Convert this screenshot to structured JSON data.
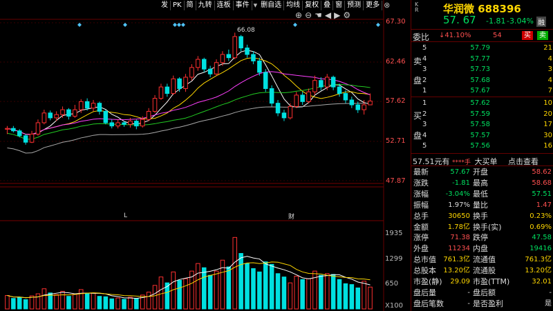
{
  "toolbar": {
    "items": [
      "发",
      "PK",
      "简",
      "九转",
      "连板",
      "事件",
      "删自选",
      "均线",
      "复权",
      "叠",
      "窗",
      "预测",
      "更多"
    ],
    "icons": [
      "fold-icon",
      "close-icon"
    ]
  },
  "controls": {
    "icons": [
      "zoom-in-icon",
      "zoom-out-icon",
      "hand-icon",
      "prev-icon",
      "next-icon",
      "settings-icon"
    ]
  },
  "price_axis": [
    "67.30",
    "62.46",
    "57.62",
    "52.71",
    "47.87"
  ],
  "volume_axis": [
    "1935",
    "1299",
    "650",
    "X100"
  ],
  "high_label": "66.08",
  "markers": {
    "l": "L",
    "cai": "财"
  },
  "chart_data": {
    "type": "candlestick",
    "ylim": [
      47.87,
      67.3
    ],
    "price_ticks": [
      67.3,
      62.46,
      57.62,
      52.71,
      47.87
    ],
    "volume_ticks": [
      1935,
      1299,
      650
    ],
    "volume_unit": "X100",
    "high": 66.08,
    "candles": [
      [
        54.2,
        54.3,
        53.6,
        54.6
      ],
      [
        54.3,
        54.0,
        53.8,
        54.6
      ],
      [
        54.0,
        53.4,
        53.2,
        54.2
      ],
      [
        53.4,
        52.6,
        52.3,
        53.6
      ],
      [
        52.6,
        53.6,
        52.5,
        54.0
      ],
      [
        53.6,
        55.0,
        53.4,
        55.4
      ],
      [
        55.0,
        56.2,
        54.8,
        56.6
      ],
      [
        56.2,
        55.6,
        55.3,
        56.5
      ],
      [
        55.6,
        56.0,
        55.2,
        56.4
      ],
      [
        56.0,
        56.6,
        55.6,
        57.0
      ],
      [
        56.6,
        55.8,
        55.4,
        56.8
      ],
      [
        55.8,
        56.6,
        55.6,
        57.2
      ],
      [
        56.6,
        57.6,
        56.2,
        57.9
      ],
      [
        57.6,
        56.8,
        56.5,
        58.0
      ],
      [
        56.8,
        57.4,
        56.4,
        57.8
      ],
      [
        57.4,
        56.4,
        56.0,
        57.6
      ],
      [
        56.4,
        55.0,
        54.8,
        56.6
      ],
      [
        55.0,
        54.6,
        54.3,
        55.4
      ],
      [
        54.6,
        55.0,
        54.3,
        55.4
      ],
      [
        55.0,
        54.8,
        54.5,
        55.2
      ],
      [
        54.8,
        55.2,
        54.4,
        55.6
      ],
      [
        55.2,
        54.6,
        54.2,
        55.4
      ],
      [
        54.6,
        55.4,
        54.4,
        55.8
      ],
      [
        55.4,
        56.4,
        55.2,
        56.8
      ],
      [
        56.4,
        58.0,
        56.2,
        58.4
      ],
      [
        58.0,
        59.4,
        57.8,
        59.8
      ],
      [
        59.4,
        58.6,
        58.2,
        59.8
      ],
      [
        58.6,
        60.4,
        58.4,
        60.8
      ],
      [
        60.4,
        59.2,
        58.8,
        60.6
      ],
      [
        59.2,
        60.6,
        58.8,
        61.0
      ],
      [
        60.6,
        61.8,
        60.2,
        62.2
      ],
      [
        61.8,
        62.8,
        61.4,
        63.2
      ],
      [
        62.8,
        61.6,
        61.2,
        63.0
      ],
      [
        61.6,
        61.0,
        60.6,
        62.0
      ],
      [
        61.0,
        62.4,
        60.8,
        62.8
      ],
      [
        62.4,
        63.4,
        62.0,
        63.8
      ],
      [
        63.4,
        63.0,
        62.6,
        64.0
      ],
      [
        63.0,
        65.6,
        62.8,
        66.08
      ],
      [
        65.6,
        64.2,
        63.8,
        65.8
      ],
      [
        64.2,
        63.4,
        63.0,
        64.6
      ],
      [
        63.4,
        62.6,
        62.2,
        63.8
      ],
      [
        62.6,
        61.2,
        60.8,
        63.0
      ],
      [
        61.2,
        59.2,
        58.8,
        61.6
      ],
      [
        59.2,
        57.4,
        57.0,
        59.6
      ],
      [
        57.4,
        56.2,
        55.8,
        57.8
      ],
      [
        56.2,
        55.6,
        55.2,
        56.6
      ],
      [
        55.6,
        57.0,
        55.4,
        57.4
      ],
      [
        57.0,
        58.4,
        56.8,
        58.8
      ],
      [
        58.4,
        57.6,
        57.2,
        58.8
      ],
      [
        57.6,
        58.8,
        57.4,
        59.2
      ],
      [
        58.8,
        60.2,
        58.4,
        60.8
      ],
      [
        60.2,
        59.4,
        59.0,
        60.6
      ],
      [
        59.4,
        60.6,
        59.0,
        61.0
      ],
      [
        60.6,
        59.4,
        59.0,
        60.8
      ],
      [
        59.4,
        58.6,
        58.2,
        59.8
      ],
      [
        58.6,
        57.8,
        57.4,
        59.0
      ],
      [
        57.8,
        57.2,
        56.8,
        58.2
      ],
      [
        57.2,
        56.6,
        56.2,
        57.6
      ],
      [
        56.6,
        57.2,
        56.0,
        57.8
      ],
      [
        57.2,
        57.67,
        57.51,
        58.6
      ]
    ],
    "volumes": [
      320,
      250,
      280,
      220,
      310,
      360,
      480,
      380,
      340,
      420,
      300,
      350,
      460,
      360,
      380,
      300,
      290,
      240,
      260,
      230,
      280,
      250,
      330,
      400,
      560,
      760,
      620,
      880,
      680,
      720,
      900,
      1080,
      980,
      800,
      900,
      1160,
      1000,
      1700,
      1320,
      1080,
      960,
      880,
      1120,
      1060,
      840,
      760,
      620,
      780,
      700,
      720,
      900,
      800,
      840,
      820,
      700,
      600,
      580,
      500,
      660,
      520
    ],
    "volume_colors": [
      "r",
      "c",
      "c",
      "c",
      "r",
      "r",
      "r",
      "c",
      "r",
      "r",
      "c",
      "r",
      "r",
      "c",
      "r",
      "c",
      "c",
      "c",
      "r",
      "c",
      "r",
      "c",
      "r",
      "r",
      "r",
      "r",
      "c",
      "r",
      "c",
      "r",
      "r",
      "r",
      "c",
      "c",
      "r",
      "r",
      "c",
      "r",
      "c",
      "c",
      "c",
      "c",
      "c",
      "c",
      "c",
      "c",
      "r",
      "r",
      "c",
      "r",
      "r",
      "c",
      "r",
      "c",
      "c",
      "c",
      "c",
      "c",
      "r",
      "r"
    ]
  },
  "panel": {
    "kr": "K R",
    "name": "华润微 688396",
    "price": "57. 67",
    "change": "-1.81",
    "pct": "-3.04%",
    "badge": "融",
    "weibi_label": "委比",
    "weibi_pct": "↓41.10%",
    "weibi_num": "54",
    "buy_btn": "买",
    "sell_btn": "卖",
    "sell_label": [
      "卖",
      "盘"
    ],
    "buy_label": [
      "买",
      "盘"
    ],
    "asks": [
      {
        "lv": "5",
        "price": "57.79",
        "vol": "21"
      },
      {
        "lv": "4",
        "price": "57.77",
        "vol": "4"
      },
      {
        "lv": "3",
        "price": "57.73",
        "vol": "3"
      },
      {
        "lv": "2",
        "price": "57.68",
        "vol": "4"
      },
      {
        "lv": "1",
        "price": "57.67",
        "vol": "7"
      }
    ],
    "bids": [
      {
        "lv": "1",
        "price": "57.62",
        "vol": "10"
      },
      {
        "lv": "2",
        "price": "57.59",
        "vol": "20"
      },
      {
        "lv": "3",
        "price": "57.58",
        "vol": "17"
      },
      {
        "lv": "4",
        "price": "57.57",
        "vol": "30"
      },
      {
        "lv": "5",
        "price": "57.56",
        "vol": "16"
      }
    ],
    "bottom": {
      "price": "57.51元有",
      "stars": "****手",
      "big": "大买单",
      "check": "点击查看"
    },
    "stats": [
      {
        "k1": "最新",
        "v1": "57.67",
        "c1": "#00e060",
        "k2": "开盘",
        "v2": "58.62",
        "c2": "#ff5050"
      },
      {
        "k1": "涨跌",
        "v1": "-1.81",
        "c1": "#00e060",
        "k2": "最高",
        "v2": "58.68",
        "c2": "#ff5050"
      },
      {
        "k1": "涨幅",
        "v1": "-3.04%",
        "c1": "#00e060",
        "k2": "最低",
        "v2": "57.51",
        "c2": "#00e060"
      },
      {
        "k1": "振幅",
        "v1": "1.97%",
        "c1": "#ddd",
        "k2": "量比",
        "v2": "1.47",
        "c2": "#ff5050"
      },
      {
        "k1": "总手",
        "v1": "30650",
        "c1": "#ffd700",
        "k2": "换手",
        "v2": "0.23%",
        "c2": "#ffd700"
      },
      {
        "k1": "金额",
        "v1": "1.78亿",
        "c1": "#ffd700",
        "k2": "换手(实)",
        "v2": "0.69%",
        "c2": "#ffd700"
      },
      {
        "k1": "涨停",
        "v1": "71.38",
        "c1": "#ff5050",
        "k2": "跌停",
        "v2": "47.58",
        "c2": "#00e060"
      },
      {
        "k1": "外盘",
        "v1": "11234",
        "c1": "#ff5050",
        "k2": "内盘",
        "v2": "19416",
        "c2": "#00e060"
      },
      {
        "k1": "总市值",
        "v1": "761.3亿",
        "c1": "#ffd700",
        "k2": "流通值",
        "v2": "761.3亿",
        "c2": "#ffd700"
      },
      {
        "k1": "总股本",
        "v1": "13.20亿",
        "c1": "#ffd700",
        "k2": "流通股",
        "v2": "13.20亿",
        "c2": "#ffd700"
      },
      {
        "k1": "市盈(静)",
        "v1": "29.09",
        "c1": "#ffd700",
        "k2": "市盈(TTM)",
        "v2": "32.01",
        "c2": "#ffd700"
      },
      {
        "k1": "盘后量",
        "v1": "-",
        "c1": "#ddd",
        "k2": "盘后额",
        "v2": "-",
        "c2": "#ddd"
      },
      {
        "k1": "盘后笔数",
        "v1": "-",
        "c1": "#ddd",
        "k2": "是否盈利",
        "v2": "是",
        "c2": "#ddd"
      }
    ]
  }
}
